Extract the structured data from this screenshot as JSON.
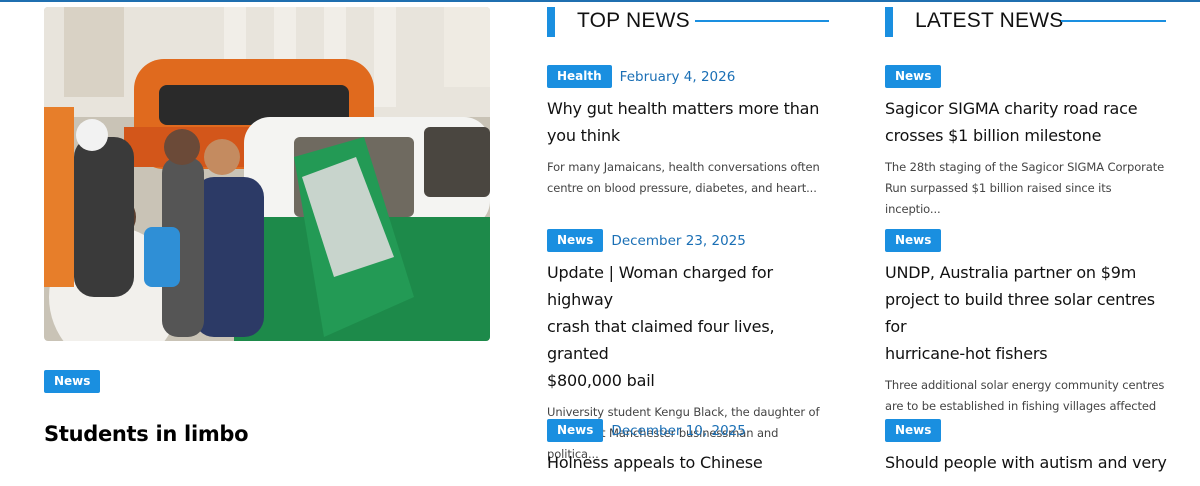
{
  "featured": {
    "image_alt": "Woman carrying child beside vintage cars",
    "badge": "News",
    "title": "Students in limbo"
  },
  "top_news": {
    "heading": "TOP NEWS",
    "items": [
      {
        "category": "Health",
        "date": "February 4, 2026",
        "title_line1": "Why gut health matters more than",
        "title_line2": "you think",
        "excerpt_line1": "For many Jamaicans, health conversations often",
        "excerpt_line2": "centre on blood pressure, diabetes, and heart..."
      },
      {
        "category": "News",
        "date": "December 23, 2025",
        "title_line1": "Update | Woman charged for highway",
        "title_line2": "crash that claimed four lives, granted",
        "title_line3": "$800,000 bail",
        "excerpt_line1": "University student Kengu Black, the daughter of",
        "excerpt_line2": "prominent Manchester businessman and politica..."
      },
      {
        "category": "News",
        "date": "December 10, 2025",
        "title_line1": "Holness appeals to Chinese"
      }
    ]
  },
  "latest_news": {
    "heading": "LATEST NEWS",
    "items": [
      {
        "category": "News",
        "title_line1": "Sagicor SIGMA charity road race",
        "title_line2": "crosses $1 billion milestone",
        "excerpt_line1": "The 28th staging of the Sagicor SIGMA Corporate",
        "excerpt_line2": "Run surpassed $1 billion raised since its inceptio..."
      },
      {
        "category": "News",
        "title_line1": "UNDP, Australia partner on $9m",
        "title_line2": "project to build three solar centres for",
        "title_line3": "hurricane-hot fishers",
        "excerpt_line1": "Three additional solar energy community centres",
        "excerpt_line2": "are to be established in fishing villages affected ..."
      },
      {
        "category": "News",
        "title_line1": "Should people with autism and very"
      }
    ]
  },
  "colors": {
    "accent": "#1a8fe0",
    "date": "#1a6fb5",
    "topline": "#1f6fb0"
  }
}
